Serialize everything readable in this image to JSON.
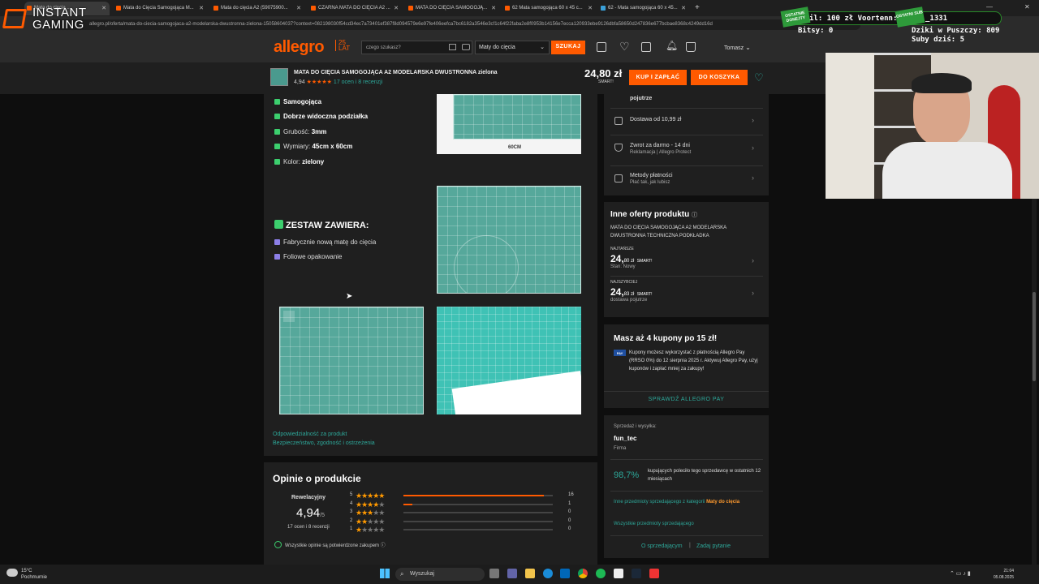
{
  "browser": {
    "tabs": [
      {
        "label": "Mata do cięcia ..."
      },
      {
        "label": "Mata do Cięcia Samogojąca M..."
      },
      {
        "label": "Mata do cięcia A2 (59075900..."
      },
      {
        "label": "CZARNA MATA DO CIĘCIA A2 ..."
      },
      {
        "label": "MATA DO CIĘCIA SAMOGOJĄ..."
      },
      {
        "label": "62 Mata samogojąca 60 x 45 c..."
      },
      {
        "label": "62 - Mata samogojąca 60 x 45..."
      }
    ],
    "new_tab": "+",
    "url": "allegro.pl/oferta/mata-do-ciecia-samogojaca-a2-modelarska-dwustronna-zielona-15058604037?context=082198030f54cd34ec7a73401ef387f8d094579e6e97fe406eefca7bc6182a3546e3cf1c64f22faba2e8f0953b14156e7ecca120933ebe9126dbfa58650d247836e677bcbae8368c4249dd16d"
  },
  "overlay": {
    "brand_line1": "INSTANT",
    "brand_line2": "GAMING",
    "last_donation": "OSTATNIE DONEJTY",
    "donation_text": "il: 100 zł  Voortenn: 1",
    "last_sub": "OSTATNI SUB",
    "sub_text": "_1331",
    "bits": "Bitsy: 0",
    "dzik": "Dziki w Puszczy: 809",
    "subs": "Suby dziś: 5"
  },
  "header": {
    "logo": "allegro",
    "logo_badge": "25 LAT",
    "search_placeholder": "czego szukasz?",
    "category": "Maty do cięcia",
    "search_button": "SZUKAJ",
    "user": "Tomasz"
  },
  "product_bar": {
    "title": "MATA DO CIĘCIA SAMOGOJĄCA A2 MODELARSKA DWUSTRONNA zielona",
    "rating": "4,94",
    "stars": "★★★★★",
    "reviews_link": "17 ocen i 8 recenzji",
    "price": "24,80 zł",
    "smart": "SMART!",
    "buy_button": "KUP I ZAPŁAĆ",
    "cart_button": "DO KOSZYKA"
  },
  "description": {
    "features": [
      {
        "label": "Samogojąca",
        "value": ""
      },
      {
        "label": "Dobrze widoczna podziałka",
        "value": ""
      },
      {
        "label": "Grubość: ",
        "value": "3mm"
      },
      {
        "label": "Wymiary: ",
        "value": "45cm x 60cm"
      },
      {
        "label": "Kolor: ",
        "value": "zielony"
      }
    ],
    "set_title": "ZESTAW ZAWIERA:",
    "set_items": [
      "Fabrycznie nową matę do cięcia",
      "Foliowe opakowanie"
    ],
    "image1_label": "60CM",
    "link_responsibility": "Odpowiedzialność za produkt",
    "link_safety": "Bezpieczeństwo, zgodność i ostrzeżenia"
  },
  "reviews": {
    "title": "Opinie o produkcie",
    "verdict": "Rewelacyjny",
    "score": "4,94",
    "score_max": "/5",
    "count": "17 ocen i 8 recenzji",
    "rows": [
      {
        "stars": 5,
        "count": "16",
        "fraction": 0.94
      },
      {
        "stars": 4,
        "count": "1",
        "fraction": 0.06
      },
      {
        "stars": 3,
        "count": "0",
        "fraction": 0
      },
      {
        "stars": 2,
        "count": "0",
        "fraction": 0
      },
      {
        "stars": 1,
        "count": "0",
        "fraction": 0
      }
    ],
    "verified": "Wszystkie opinie są potwierdzone zakupem"
  },
  "sidebar": {
    "delivery_top": "pojutrze",
    "delivery": "Dostawa od 10,99 zł",
    "returns": "Zwrot za darmo - 14 dni",
    "returns_sub": "Reklamacja | Allegro Protect",
    "payment": "Metody płatności",
    "payment_sub": "Płać tak, jak lubisz",
    "other_title": "Inne oferty produktu",
    "other_desc": "MATA DO CIĘCIA SAMOGOJĄCA A2 MODELARSKA DWUSTRONNA TECHNICZNA PODKŁADKA",
    "offers": [
      {
        "label": "NAJTAŃSZE",
        "price_main": "24,",
        "price_cents": "80 zł",
        "smart": "SMART!",
        "sub": "Stan: Nowy"
      },
      {
        "label": "NAJSZYBCIEJ",
        "price_main": "24,",
        "price_cents": "83 zł",
        "smart": "SMART!",
        "sub": "dostawa pojutrze"
      }
    ],
    "coupons_title": "Masz aż 4 kupony po 15 zł!",
    "pay_badge": "PAY",
    "coupons_text": "Kupony możesz wykorzystać z płatnością Allegro Pay (RRSO 0%) do 12 sierpnia 2025 r. Aktywuj Allegro Pay, użyj kuponów i zapłać mniej za zakupy!",
    "coupons_link": "SPRAWDŹ ALLEGRO PAY",
    "seller_label": "Sprzedaż i wysyłka:",
    "seller_name": "fun_tec",
    "seller_type": "Firma",
    "seller_pct": "98,7%",
    "seller_pct_desc": "kupujących poleciło tego sprzedawcę w ostatnich 12 miesiącach",
    "seller_other": "Inne przedmioty sprzedającego z kategorii ",
    "seller_other_cat": "Maty do cięcia",
    "seller_all": "Wszystkie przedmioty sprzedającego",
    "seller_about": "O sprzedającym",
    "seller_sep": "|",
    "seller_ask": "Zadaj pytanie"
  },
  "taskbar": {
    "temp": "15°C",
    "weather": "Pochmurnie",
    "search": "Wyszukaj",
    "time": "21:04",
    "date": "05.08.2025"
  },
  "colors": {
    "accent": "#ff5a00",
    "teal": "#2da89a",
    "check": "#3ccf6e"
  }
}
